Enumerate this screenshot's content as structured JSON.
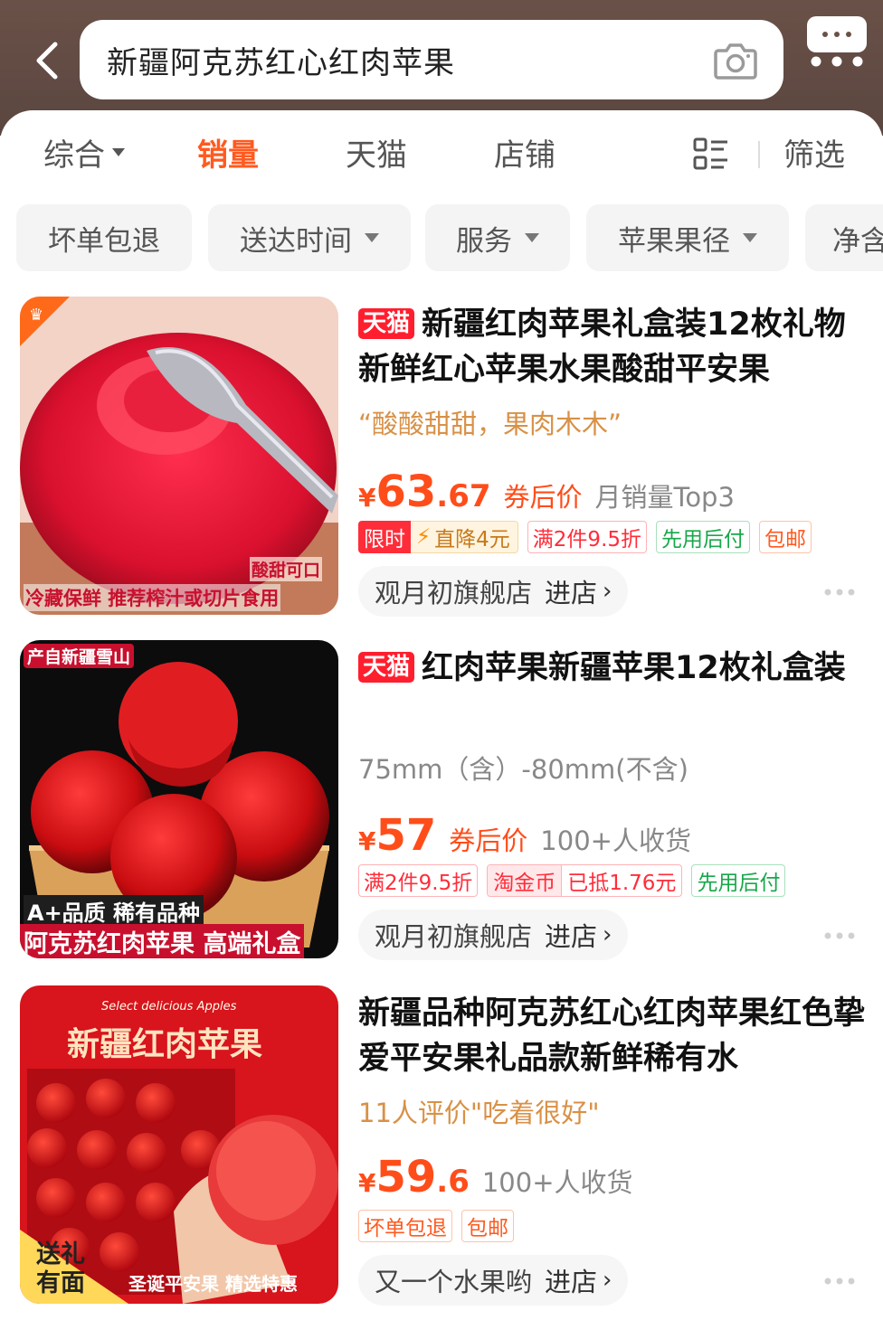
{
  "header": {
    "search_text": "新疆阿克苏红心红肉苹果"
  },
  "sort_tabs": [
    {
      "label": "综合",
      "has_caret": true
    },
    {
      "label": "销量",
      "active": true
    },
    {
      "label": "天猫"
    },
    {
      "label": "店铺"
    }
  ],
  "filter_label": "筛选",
  "filter_chips": [
    {
      "label": "坏单包退"
    },
    {
      "label": "送达时间"
    },
    {
      "label": "服务"
    },
    {
      "label": "苹果果径"
    },
    {
      "label": "净含"
    }
  ],
  "products": [
    {
      "badge": "天猫",
      "title": "新疆红肉苹果礼盒装12枚礼物新鲜红心苹果水果酸甜平安果",
      "subline": "“酸酸甜甜，果肉木木”",
      "currency": "¥",
      "price_int": "63",
      "price_dec": ".67",
      "after_coupon": "券后价",
      "sales": "月销量Top3",
      "tag_flash_left": "限时",
      "tag_flash_right": "直降4元",
      "tags": [
        "满2件9.5折",
        "先用后付",
        "包邮"
      ],
      "shop": "观月初旗舰店",
      "enter": "进店",
      "image_caption_1": "酸甜可口",
      "image_caption_2": "冷藏保鲜 推荐榨汁或切片食用"
    },
    {
      "badge": "天猫",
      "title": "红肉苹果新疆苹果12枚礼盒装",
      "subline": "75mm（含）-80mm(不含)",
      "currency": "¥",
      "price_int": "57",
      "after_coupon": "券后价",
      "sales": "100+人收货",
      "tags_before": [
        "满2件9.5折"
      ],
      "tag_jb_left": "淘金币",
      "tag_jb_right": "已抵1.76元",
      "tags_after": [
        "先用后付"
      ],
      "shop": "观月初旗舰店",
      "enter": "进店",
      "image_caption_top": "产自新疆雪山",
      "image_caption_1": "A+品质 稀有品种",
      "image_caption_2": "阿克苏红肉苹果 高端礼盒"
    },
    {
      "title": "新疆品种阿克苏红心红肉苹果红色挚爱平安果礼品款新鲜稀有水",
      "subline": "11人评价\"吃着很好\"",
      "currency": "¥",
      "price_int": "59",
      "price_dec": ".6",
      "sales": "100+人收货",
      "tags": [
        "坏单包退",
        "包邮"
      ],
      "shop": "又一个水果哟",
      "enter": "进店",
      "image_caption_top": "Select delicious Apples",
      "image_caption_title": "新疆红肉苹果",
      "image_caption_1": "送礼\n有面",
      "image_caption_2": "圣诞平安果 精选特惠"
    }
  ],
  "colors": {
    "accent": "#ff5a1f",
    "tmall_red": "#ff1e2e",
    "header_bg": "#5f4a43"
  }
}
